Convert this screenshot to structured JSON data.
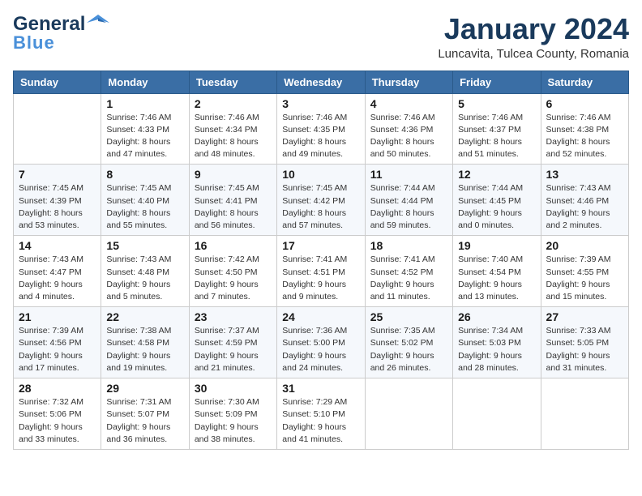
{
  "header": {
    "logo_line1": "General",
    "logo_line2": "Blue",
    "month": "January 2024",
    "location": "Luncavita, Tulcea County, Romania"
  },
  "weekdays": [
    "Sunday",
    "Monday",
    "Tuesday",
    "Wednesday",
    "Thursday",
    "Friday",
    "Saturday"
  ],
  "weeks": [
    [
      {
        "day": "",
        "sunrise": "",
        "sunset": "",
        "daylight": ""
      },
      {
        "day": "1",
        "sunrise": "Sunrise: 7:46 AM",
        "sunset": "Sunset: 4:33 PM",
        "daylight": "Daylight: 8 hours and 47 minutes."
      },
      {
        "day": "2",
        "sunrise": "Sunrise: 7:46 AM",
        "sunset": "Sunset: 4:34 PM",
        "daylight": "Daylight: 8 hours and 48 minutes."
      },
      {
        "day": "3",
        "sunrise": "Sunrise: 7:46 AM",
        "sunset": "Sunset: 4:35 PM",
        "daylight": "Daylight: 8 hours and 49 minutes."
      },
      {
        "day": "4",
        "sunrise": "Sunrise: 7:46 AM",
        "sunset": "Sunset: 4:36 PM",
        "daylight": "Daylight: 8 hours and 50 minutes."
      },
      {
        "day": "5",
        "sunrise": "Sunrise: 7:46 AM",
        "sunset": "Sunset: 4:37 PM",
        "daylight": "Daylight: 8 hours and 51 minutes."
      },
      {
        "day": "6",
        "sunrise": "Sunrise: 7:46 AM",
        "sunset": "Sunset: 4:38 PM",
        "daylight": "Daylight: 8 hours and 52 minutes."
      }
    ],
    [
      {
        "day": "7",
        "sunrise": "Sunrise: 7:45 AM",
        "sunset": "Sunset: 4:39 PM",
        "daylight": "Daylight: 8 hours and 53 minutes."
      },
      {
        "day": "8",
        "sunrise": "Sunrise: 7:45 AM",
        "sunset": "Sunset: 4:40 PM",
        "daylight": "Daylight: 8 hours and 55 minutes."
      },
      {
        "day": "9",
        "sunrise": "Sunrise: 7:45 AM",
        "sunset": "Sunset: 4:41 PM",
        "daylight": "Daylight: 8 hours and 56 minutes."
      },
      {
        "day": "10",
        "sunrise": "Sunrise: 7:45 AM",
        "sunset": "Sunset: 4:42 PM",
        "daylight": "Daylight: 8 hours and 57 minutes."
      },
      {
        "day": "11",
        "sunrise": "Sunrise: 7:44 AM",
        "sunset": "Sunset: 4:44 PM",
        "daylight": "Daylight: 8 hours and 59 minutes."
      },
      {
        "day": "12",
        "sunrise": "Sunrise: 7:44 AM",
        "sunset": "Sunset: 4:45 PM",
        "daylight": "Daylight: 9 hours and 0 minutes."
      },
      {
        "day": "13",
        "sunrise": "Sunrise: 7:43 AM",
        "sunset": "Sunset: 4:46 PM",
        "daylight": "Daylight: 9 hours and 2 minutes."
      }
    ],
    [
      {
        "day": "14",
        "sunrise": "Sunrise: 7:43 AM",
        "sunset": "Sunset: 4:47 PM",
        "daylight": "Daylight: 9 hours and 4 minutes."
      },
      {
        "day": "15",
        "sunrise": "Sunrise: 7:43 AM",
        "sunset": "Sunset: 4:48 PM",
        "daylight": "Daylight: 9 hours and 5 minutes."
      },
      {
        "day": "16",
        "sunrise": "Sunrise: 7:42 AM",
        "sunset": "Sunset: 4:50 PM",
        "daylight": "Daylight: 9 hours and 7 minutes."
      },
      {
        "day": "17",
        "sunrise": "Sunrise: 7:41 AM",
        "sunset": "Sunset: 4:51 PM",
        "daylight": "Daylight: 9 hours and 9 minutes."
      },
      {
        "day": "18",
        "sunrise": "Sunrise: 7:41 AM",
        "sunset": "Sunset: 4:52 PM",
        "daylight": "Daylight: 9 hours and 11 minutes."
      },
      {
        "day": "19",
        "sunrise": "Sunrise: 7:40 AM",
        "sunset": "Sunset: 4:54 PM",
        "daylight": "Daylight: 9 hours and 13 minutes."
      },
      {
        "day": "20",
        "sunrise": "Sunrise: 7:39 AM",
        "sunset": "Sunset: 4:55 PM",
        "daylight": "Daylight: 9 hours and 15 minutes."
      }
    ],
    [
      {
        "day": "21",
        "sunrise": "Sunrise: 7:39 AM",
        "sunset": "Sunset: 4:56 PM",
        "daylight": "Daylight: 9 hours and 17 minutes."
      },
      {
        "day": "22",
        "sunrise": "Sunrise: 7:38 AM",
        "sunset": "Sunset: 4:58 PM",
        "daylight": "Daylight: 9 hours and 19 minutes."
      },
      {
        "day": "23",
        "sunrise": "Sunrise: 7:37 AM",
        "sunset": "Sunset: 4:59 PM",
        "daylight": "Daylight: 9 hours and 21 minutes."
      },
      {
        "day": "24",
        "sunrise": "Sunrise: 7:36 AM",
        "sunset": "Sunset: 5:00 PM",
        "daylight": "Daylight: 9 hours and 24 minutes."
      },
      {
        "day": "25",
        "sunrise": "Sunrise: 7:35 AM",
        "sunset": "Sunset: 5:02 PM",
        "daylight": "Daylight: 9 hours and 26 minutes."
      },
      {
        "day": "26",
        "sunrise": "Sunrise: 7:34 AM",
        "sunset": "Sunset: 5:03 PM",
        "daylight": "Daylight: 9 hours and 28 minutes."
      },
      {
        "day": "27",
        "sunrise": "Sunrise: 7:33 AM",
        "sunset": "Sunset: 5:05 PM",
        "daylight": "Daylight: 9 hours and 31 minutes."
      }
    ],
    [
      {
        "day": "28",
        "sunrise": "Sunrise: 7:32 AM",
        "sunset": "Sunset: 5:06 PM",
        "daylight": "Daylight: 9 hours and 33 minutes."
      },
      {
        "day": "29",
        "sunrise": "Sunrise: 7:31 AM",
        "sunset": "Sunset: 5:07 PM",
        "daylight": "Daylight: 9 hours and 36 minutes."
      },
      {
        "day": "30",
        "sunrise": "Sunrise: 7:30 AM",
        "sunset": "Sunset: 5:09 PM",
        "daylight": "Daylight: 9 hours and 38 minutes."
      },
      {
        "day": "31",
        "sunrise": "Sunrise: 7:29 AM",
        "sunset": "Sunset: 5:10 PM",
        "daylight": "Daylight: 9 hours and 41 minutes."
      },
      {
        "day": "",
        "sunrise": "",
        "sunset": "",
        "daylight": ""
      },
      {
        "day": "",
        "sunrise": "",
        "sunset": "",
        "daylight": ""
      },
      {
        "day": "",
        "sunrise": "",
        "sunset": "",
        "daylight": ""
      }
    ]
  ]
}
